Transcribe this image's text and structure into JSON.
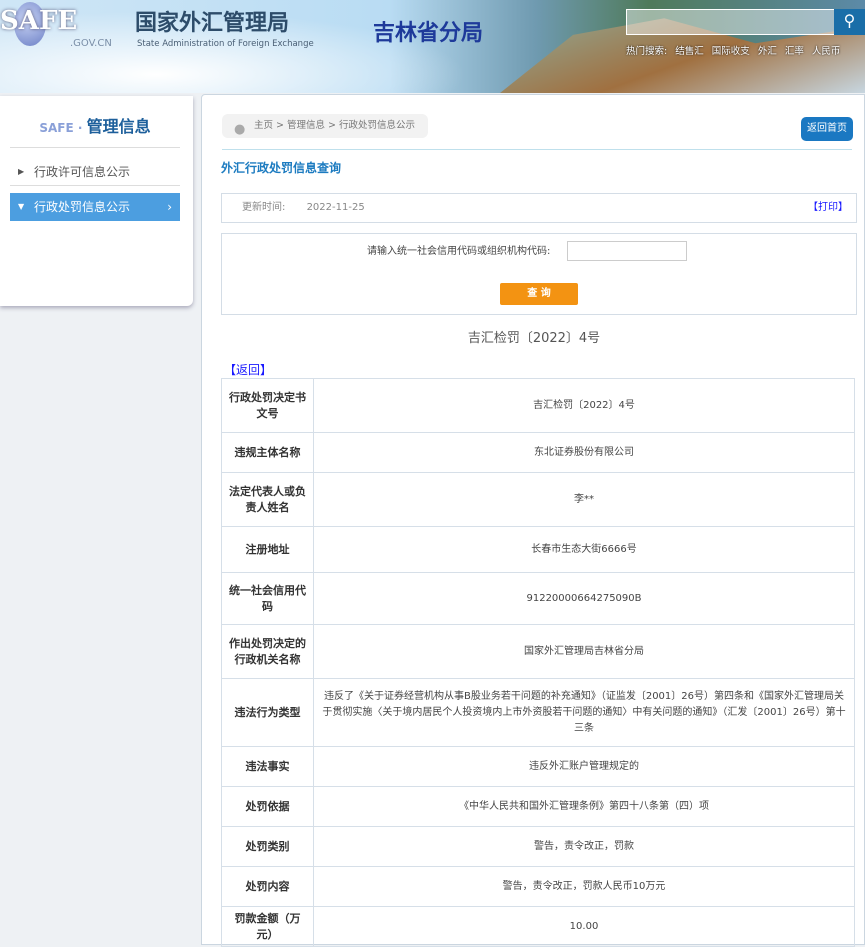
{
  "header": {
    "logo": "SAFE",
    "domain": ".GOV.CN",
    "title_cn": "国家外汇管理局",
    "title_en": "State Administration of Foreign Exchange",
    "branch": "吉林省分局",
    "search_placeholder": "",
    "hot_label": "热门搜索:",
    "hot": [
      "结售汇",
      "国际收支",
      "外汇",
      "汇率",
      "人民币"
    ]
  },
  "sidebar": {
    "title": "管理信息",
    "items": [
      {
        "label": "行政许可信息公示"
      },
      {
        "label": "行政处罚信息公示"
      }
    ]
  },
  "main": {
    "breadcrumb": "主页 > 管理信息 > 行政处罚信息公示",
    "home_button": "返回首页",
    "query_title": "外汇行政处罚信息查询",
    "update_label": "更新时间:",
    "update_date": "2022-11-25",
    "print": "【打印】",
    "input_label": "请输入统一社会信用代码或组织机构代码:",
    "input_value": "",
    "query_button": "查 询",
    "doc_no": "吉汇检罚〔2022〕4号",
    "back": "【返回】",
    "rows": [
      {
        "k": "行政处罚决定书文号",
        "v": "吉汇检罚〔2022〕4号"
      },
      {
        "k": "违规主体名称",
        "v": "东北证券股份有限公司"
      },
      {
        "k": "法定代表人或负责人姓名",
        "v": "李**"
      },
      {
        "k": "注册地址",
        "v": "长春市生态大街6666号"
      },
      {
        "k": "统一社会信用代码",
        "v": "91220000664275090B"
      },
      {
        "k": "作出处罚决定的行政机关名称",
        "v": "国家外汇管理局吉林省分局"
      },
      {
        "k": "违法行为类型",
        "v": "违反了《关于证券经营机构从事B股业务若干问题的补充通知》（证监发〔2001〕26号）第四条和《国家外汇管理局关于贯彻实施〈关于境内居民个人投资境内上市外资股若干问题的通知〉中有关问题的通知》（汇发〔2001〕26号）第十三条"
      },
      {
        "k": "违法事实",
        "v": "违反外汇账户管理规定的"
      },
      {
        "k": "处罚依据",
        "v": "《中华人民共和国外汇管理条例》第四十八条第（四）项"
      },
      {
        "k": "处罚类别",
        "v": "警告，责令改正，罚款"
      },
      {
        "k": "处罚内容",
        "v": "警告，责令改正，罚款人民币10万元"
      },
      {
        "k": "罚款金额（万元）",
        "v": "10.00"
      }
    ]
  }
}
